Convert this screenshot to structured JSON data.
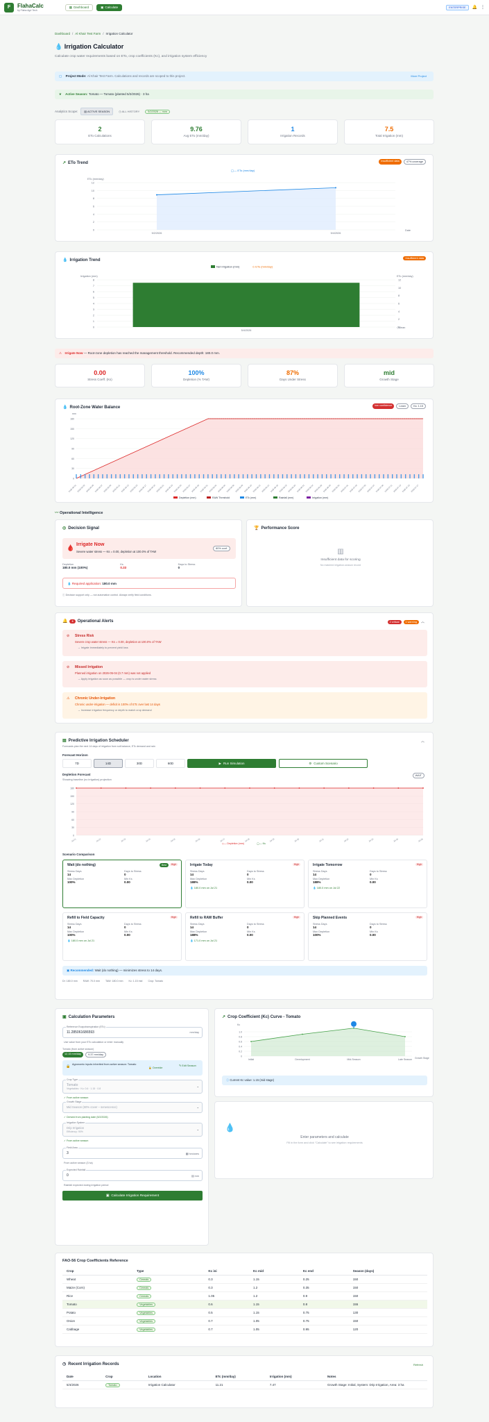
{
  "app": {
    "name": "FlahaCalc",
    "subtitle": "by Flaha Agri Tech",
    "nav_dashboard": "Dashboard",
    "nav_calculate": "Calculate",
    "plan_badge": "ENTERPRISE"
  },
  "breadcrumb": {
    "home": "Dashboard",
    "farm": "Al Khair Test Farm",
    "current": "Irrigation Calculator"
  },
  "page": {
    "title": "Irrigation Calculator",
    "subtitle": "Calculate crop water requirements based on ETo, crop coefficients (Kc), and irrigation system efficiency"
  },
  "project_banner": {
    "label": "Project Mode:",
    "text": "Al Khair Test Farm. Calculations and records are scoped to this project.",
    "action": "More Project"
  },
  "season_banner": {
    "label": "Active Season:",
    "text": "Tomato — Tomato (planted 5/2/2026) · 3 ha"
  },
  "analytics_scope": {
    "label": "Analytics Scope:",
    "active": "ACTIVE SEASON",
    "all": "ALL HISTORY",
    "range": "5/2/2026 — now"
  },
  "stats": [
    {
      "value": "2",
      "label": "ETo Calculations",
      "color": "#2e7d32"
    },
    {
      "value": "9.76",
      "label": "Avg ETo (mm/day)",
      "color": "#2e7d32"
    },
    {
      "value": "1",
      "label": "Irrigation Records",
      "color": "#1e88e5"
    },
    {
      "value": "7.5",
      "label": "Total Irrigation (mm)",
      "color": "#ef6c00"
    }
  ],
  "eto_trend": {
    "title": "ETo Trend",
    "badge_insufficient": "Insufficient data",
    "badge_coverage": "47% coverage",
    "legend": "ETo (mm/day)",
    "ylabel": "ETo (mm/day)",
    "xlabel": "Date"
  },
  "irrigation_trend": {
    "title": "Irrigation Trend",
    "badge": "Insufficient data",
    "legend_net": "Net Irrigation (mm)",
    "legend_eto": "ETo (mm/day)",
    "ylabel_left": "Irrigation (mm)",
    "ylabel_right": "ETo (mm/day)"
  },
  "alert_irrigate": {
    "label": "Irrigate Now",
    "text": "— Root-zone depletion has reached the management threshold. Recommended depth: 180.0 mm."
  },
  "status_cards": [
    {
      "value": "0.00",
      "label": "Stress Coeff. (Ks)",
      "color": "#dc2626"
    },
    {
      "value": "100%",
      "label": "Depletion (% TAW)",
      "color": "#1e88e5"
    },
    {
      "value": "87%",
      "label": "Days Under Stress",
      "color": "#ef6c00"
    },
    {
      "value": "mid",
      "label": "Growth Stage",
      "color": "#2e7d32"
    }
  ],
  "root_zone": {
    "title": "Root-Zone Water Balance",
    "badge_low": "low confidence",
    "badge_learn": "Learn",
    "badge_ks": "Ks: 1.15",
    "ylabel": "mm",
    "legend": [
      "Depletion (mm)",
      "RAW Threshold",
      "ETc (mm)",
      "Rainfall (mm)",
      "Irrigation (mm)"
    ]
  },
  "operational": {
    "title": "Operational Intelligence"
  },
  "decision": {
    "title": "Decision Signal",
    "signal": "Irrigate Now",
    "detail": "Severe water stress — Ks = 0.00, depletion at 100.0% of TAW",
    "confidence": "80% conf.",
    "dep_label": "Depletion",
    "dep_val": "180.0 mm (100%)",
    "ks_label": "Ks",
    "ks_val": "0.33",
    "days_label": "Days to Stress",
    "days_val": "0",
    "req_label": "Required application:",
    "req_val": "180.0 mm",
    "footnote": "Decision support only — not automation control. Always verify field conditions."
  },
  "performance": {
    "title": "Performance Score",
    "empty_title": "Insufficient data for scoring",
    "empty_sub": "No matched irrigation-season record"
  },
  "op_alerts": {
    "title": "Operational Alerts",
    "count": "3",
    "badge_critical": "2 critical",
    "badge_warning": "1 warning",
    "items": [
      {
        "title": "Stress Risk",
        "text": "Severe crop water stress — Ks = 0.00, depletion at 100.0% of TAW",
        "action": "Irrigate immediately to prevent yield loss",
        "level": "critical"
      },
      {
        "title": "Missed Irrigation",
        "text": "Planned irrigation on 2026-05-04 (0.7 mm) was not applied",
        "action": "Apply irrigation as soon as possible — crop is under water stress",
        "level": "critical"
      },
      {
        "title": "Chronic Under-Irrigation",
        "text": "Chronic under-irrigation — deficit is 100% of ETc over last 14 days",
        "action": "Increase irrigation frequency or depth to match crop demand",
        "level": "warning"
      }
    ]
  },
  "scheduler": {
    "title": "Predictive Irrigation Scheduler",
    "subtitle": "Forecasts plan the next 14 days of irrigation from soil balance, ETc demand and rain",
    "horizon_label": "Forecast Horizon",
    "horizons": [
      "7D",
      "14D",
      "30D",
      "60D"
    ],
    "active_horizon": "14D",
    "run_button": "Run Simulation",
    "custom_button": "Custom Scenario",
    "projection_label": "Depletion Forecast",
    "projection_note": "Showing baseline (no irrigation) projection",
    "toggle": "WAIT",
    "legend": [
      "Depletion (mm)",
      "Ks"
    ],
    "comparison_label": "Scenario Comparison",
    "scenarios": [
      {
        "title": "Wait (do nothing)",
        "best": "Best",
        "high": "High",
        "stress_days": "14",
        "days_to_stress": "0",
        "max_dep": "100%",
        "min_ks": "0.00",
        "note": ""
      },
      {
        "title": "Irrigate Today",
        "high": "High",
        "stress_days": "14",
        "days_to_stress": "0",
        "max_dep": "188%",
        "min_ks": "0.00",
        "note": "180.0 mm on Jul 21"
      },
      {
        "title": "Irrigate Tomorrow",
        "high": "High",
        "stress_days": "14",
        "days_to_stress": "0",
        "max_dep": "188%",
        "min_ks": "0.00",
        "note": "180.0 mm on Jul 22"
      },
      {
        "title": "Refill to Field Capacity",
        "high": "High",
        "stress_days": "14",
        "days_to_stress": "0",
        "max_dep": "100%",
        "min_ks": "0.00",
        "note": "180.0 mm on Jul 21"
      },
      {
        "title": "Refill to RAW Buffer",
        "high": "High",
        "stress_days": "14",
        "days_to_stress": "0",
        "max_dep": "188%",
        "min_ks": "0.00",
        "note": "171.0 mm on Jul 21"
      },
      {
        "title": "Skip Planned Events",
        "high": "High",
        "stress_days": "14",
        "days_to_stress": "0",
        "max_dep": "100%",
        "min_ks": "0.00",
        "note": ""
      }
    ],
    "lbl_stress_days": "Stress Days",
    "lbl_days_to": "Days to Stress",
    "lbl_max_dep": "Max Depletion",
    "lbl_min_ks": "Min Ks",
    "recommend_label": "Recommended:",
    "recommend_text": "Wait (do nothing) — minimizes stress to 14 days.",
    "footer": [
      "Dr: 180.0 mm",
      "RAW: 70.0 mm",
      "TAW: 180.0 mm",
      "Kc: 1.15 mid",
      "Crop: Tomato"
    ]
  },
  "calc": {
    "title": "Calculation Parameters",
    "eto_label": "Reference Evapotranspiration (ETo)",
    "eto_value": "11.285061686593",
    "eto_unit": "mm/day",
    "eto_hint": "Use value from your ETo calculation or enter manually",
    "tabs_label": "Tomato (from active season)",
    "tab_a": "12.15 mm/day",
    "tab_b": "9.37 mm/day",
    "locked_text": "Agronomic inputs inherited from active season: Tomato",
    "override": "Override",
    "edit_season": "Edit Season",
    "crop_label": "Crop Type",
    "crop_value": "Tomato",
    "crop_sub": "Vegetables · Kc: 0.6 · 1.15 · 0.8",
    "from_active": "From active season",
    "stage_label": "Growth Stage",
    "stage_value": "Mid Season (60% cover – senescence)",
    "stage_hint": "Derived from planting date (5/2/2026)",
    "system_label": "Irrigation System",
    "system_value": "Drip Irrigation",
    "system_sub": "Efficiency: 90%",
    "from_active2": "From active season",
    "area_label": "Field Area",
    "area_value": "3",
    "area_unit": "hectares",
    "area_hint": "From active season (3 ha)",
    "rain_label": "Expected Rainfall",
    "rain_value": "0",
    "rain_unit": "mm",
    "rain_hint": "Rainfall expected during irrigation period",
    "button": "Calculate Irrigation Requirement"
  },
  "kc_curve": {
    "title": "Crop Coefficient (Kc) Curve - Tomato",
    "stages": [
      "Initial",
      "Development",
      "Mid-Season",
      "Late Season"
    ],
    "xaxis": "Growth Stage",
    "ylabel": "Kc",
    "info": "Current Kc value: 1.15 (mid stage)"
  },
  "results": {
    "title": "Enter parameters and calculate",
    "sub": "Fill in the form and click \"Calculate\" to see irrigation requirements"
  },
  "fao": {
    "title": "FAO-56 Crop Coefficients Reference",
    "headers": [
      "Crop",
      "Type",
      "Kc ini",
      "Kc mid",
      "Kc end",
      "Season (days)"
    ],
    "rows": [
      [
        "Wheat",
        "Cereals",
        "0.3",
        "1.15",
        "0.25",
        "150"
      ],
      [
        "Maize (Corn)",
        "Cereals",
        "0.3",
        "1.2",
        "0.35",
        "150"
      ],
      [
        "Rice",
        "Cereals",
        "1.05",
        "1.2",
        "0.9",
        "150"
      ],
      [
        "Tomato",
        "Vegetables",
        "0.6",
        "1.15",
        "0.8",
        "155"
      ],
      [
        "Potato",
        "Vegetables",
        "0.5",
        "1.15",
        "0.75",
        "130"
      ],
      [
        "Onion",
        "Vegetables",
        "0.7",
        "1.05",
        "0.75",
        "150"
      ],
      [
        "Cabbage",
        "Vegetables",
        "0.7",
        "1.05",
        "0.95",
        "120"
      ]
    ]
  },
  "records": {
    "title": "Recent Irrigation Records",
    "refresh": "Refresh",
    "headers": [
      "Date",
      "Crop",
      "Location",
      "ETc (mm/day)",
      "Irrigation (mm)",
      "Notes"
    ],
    "rows": [
      [
        "5/4/2026",
        "Tomato",
        "Irrigation Calculator",
        "11.21",
        "7.47",
        "Growth Stage: Initial, System: Drip Irrigation, Area: 3 ha"
      ]
    ]
  },
  "chart_data": [
    {
      "type": "line",
      "title": "ETo Trend",
      "x": [
        "5/2/2026",
        "5/4/2026"
      ],
      "series": [
        {
          "name": "ETo (mm/day)",
          "values": [
            8.9,
            10.7
          ]
        }
      ],
      "ylim": [
        0,
        12
      ],
      "ylabel": "ETo (mm/day)",
      "xlabel": "Date",
      "yticks": [
        "0",
        "2",
        "4",
        "6",
        "8",
        "10",
        "12"
      ]
    },
    {
      "type": "bar",
      "title": "Irrigation Trend",
      "categories": [
        "5/4/2026"
      ],
      "series": [
        {
          "name": "Net Irrigation (mm)",
          "values": [
            7.5
          ]
        },
        {
          "name": "ETo (mm/day)",
          "values": [
            11.2
          ]
        }
      ],
      "ylim": [
        0,
        8
      ],
      "ylim_right": [
        0,
        12
      ],
      "yticks": [
        "0",
        "1",
        "2",
        "3",
        "4",
        "5",
        "6",
        "7",
        "8"
      ],
      "yticks_right": [
        "0",
        "2",
        "4",
        "6",
        "8",
        "10",
        "12"
      ]
    },
    {
      "type": "area",
      "title": "Root-Zone Water Balance",
      "ylim": [
        0,
        180
      ],
      "yticks": [
        "0",
        "30",
        "60",
        "90",
        "120",
        "150",
        "180"
      ],
      "ramp_until_fraction": 0.38,
      "depletion_max": 180,
      "raw_threshold": 180,
      "xcount": 80
    },
    {
      "type": "area",
      "title": "Depletion Forecast",
      "ylim": [
        0,
        180
      ],
      "yticks": [
        "0",
        "30",
        "60",
        "90",
        "120",
        "150",
        "180"
      ],
      "depletion": 180,
      "xcount": 15
    },
    {
      "type": "line",
      "title": "Crop Coefficient (Kc) Curve - Tomato",
      "stages": [
        "Initial",
        "Development",
        "Mid-Season",
        "Late Season"
      ],
      "values": [
        0.6,
        0.9,
        1.15,
        0.8
      ],
      "ylim": [
        0,
        1.2
      ],
      "yticks": [
        "0",
        "0.2",
        "0.4",
        "0.6",
        "0.8",
        "1.0"
      ]
    }
  ]
}
